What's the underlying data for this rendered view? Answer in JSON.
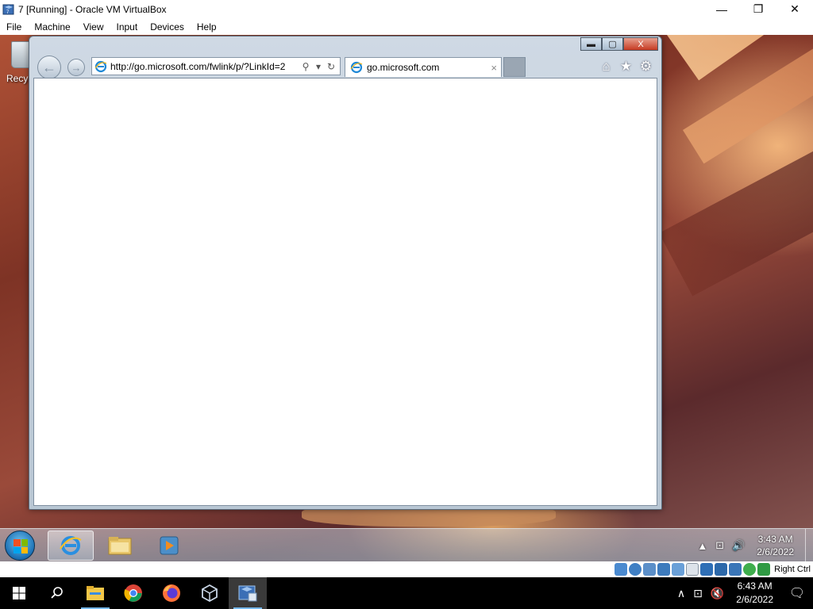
{
  "host_window": {
    "title": "7 [Running] - Oracle VM VirtualBox",
    "minimize": "—",
    "maximize": "❐",
    "close": "✕"
  },
  "host_menu": [
    "File",
    "Machine",
    "View",
    "Input",
    "Devices",
    "Help"
  ],
  "desktop": {
    "recycle_label": "Recy"
  },
  "browser": {
    "address_value": "http://go.microsoft.com/fwlink/p/?LinkId=2",
    "search_glyph": "⚲",
    "dropdown_glyph": "▾",
    "refresh_glyph": "↻",
    "tab_title": "go.microsoft.com",
    "tab_close": "×",
    "back_glyph": "←",
    "forward_glyph": "→",
    "home_glyph": "⌂",
    "favorites_glyph": "★",
    "tools_glyph": "⚙",
    "caption_min": "▬",
    "caption_max": "▢",
    "caption_close": "X"
  },
  "vm_taskbar": {
    "clock_time": "3:43 AM",
    "clock_date": "2/6/2022",
    "tray_up": "▲",
    "tray_network": "⊡",
    "tray_volume": "🔊"
  },
  "vb_status": {
    "host_key": "Right Ctrl"
  },
  "host_taskbar": {
    "clock_time": "6:43 AM",
    "clock_date": "2/6/2022",
    "tray_up": "∧",
    "tray_network": "⊡",
    "tray_volume": "🔇",
    "notifications": "🗨"
  },
  "colors": {
    "host_accent": "#76b9ed",
    "ie_frame": "#b9c7d4",
    "close_red": "#c53a22"
  }
}
